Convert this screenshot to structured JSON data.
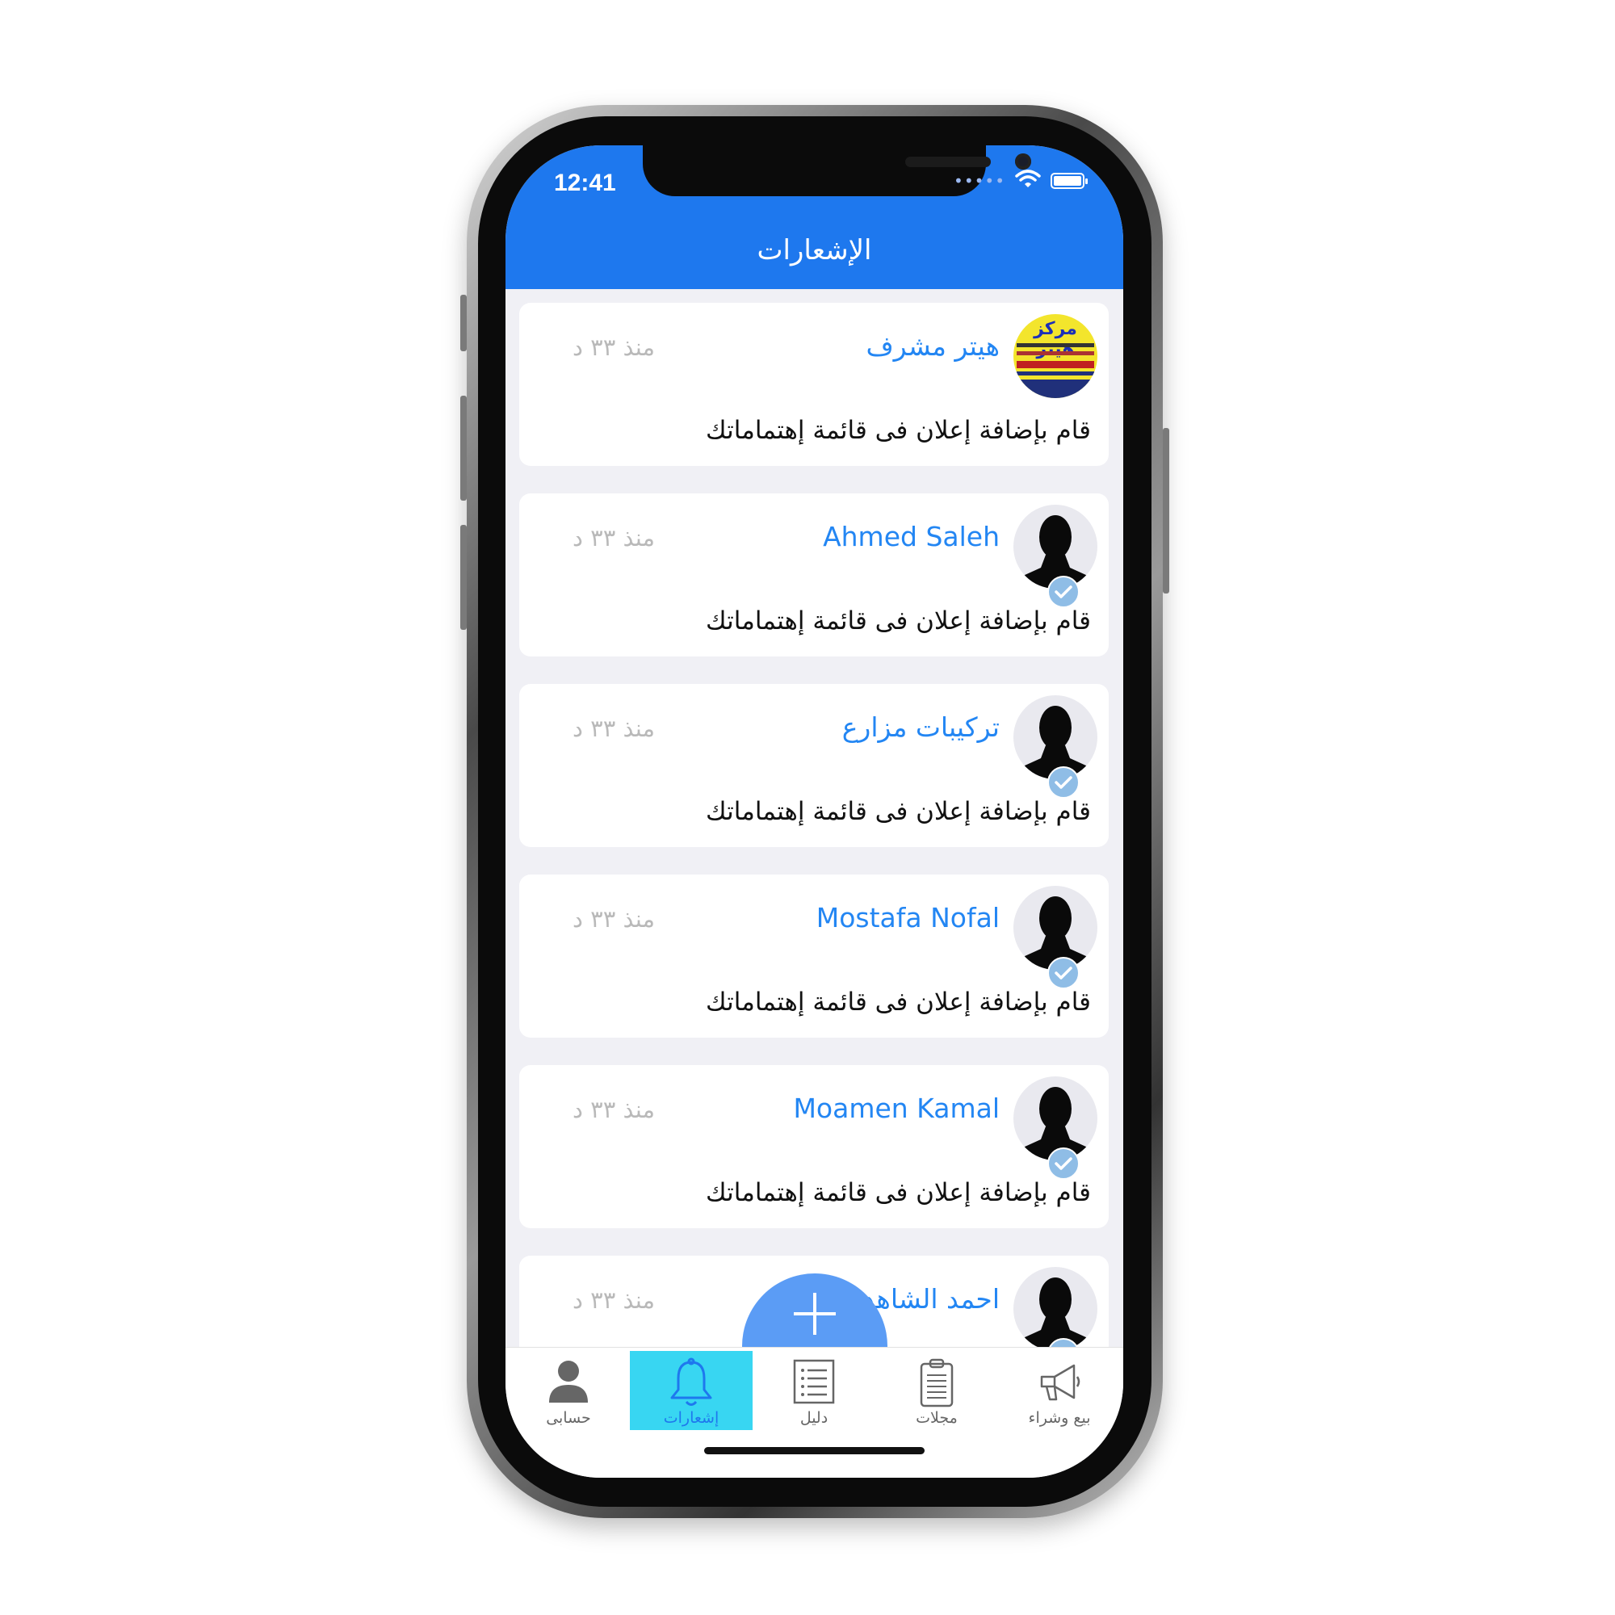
{
  "status_bar": {
    "time": "12:41",
    "signal_dots": "•••••"
  },
  "header": {
    "title": "الإشعارات"
  },
  "notifications": [
    {
      "name": "هيتر مشرف",
      "time": "منذ ٣٣ د",
      "message": "قام بإضافة إعلان فى قائمة إهتماماتك",
      "avatar": "logo"
    },
    {
      "name": "Ahmed Saleh",
      "time": "منذ ٣٣ د",
      "message": "قام بإضافة إعلان فى قائمة إهتماماتك",
      "avatar": "person"
    },
    {
      "name": "تركيبات مزارع",
      "time": "منذ ٣٣ د",
      "message": "قام بإضافة إعلان فى قائمة إهتماماتك",
      "avatar": "person"
    },
    {
      "name": "Mostafa Nofal",
      "time": "منذ ٣٣ د",
      "message": "قام بإضافة إعلان فى قائمة إهتماماتك",
      "avatar": "person"
    },
    {
      "name": "Moamen Kamal",
      "time": "منذ ٣٣ د",
      "message": "قام بإضافة إعلان فى قائمة إهتماماتك",
      "avatar": "person"
    },
    {
      "name": "احمد الشاهد",
      "time": "منذ ٣٣ د",
      "message": "",
      "avatar": "person"
    }
  ],
  "logo": {
    "title": "مركز هيتر"
  },
  "tabs": [
    {
      "label": "حسابى",
      "icon": "user-icon"
    },
    {
      "label": "إشعارات",
      "icon": "bell-icon",
      "active": true
    },
    {
      "label": "دليل",
      "icon": "list-icon"
    },
    {
      "label": "مجلات",
      "icon": "clipboard-icon"
    },
    {
      "label": "بيع وشراء",
      "icon": "megaphone-icon"
    }
  ],
  "fab": {
    "icon": "plus-icon"
  },
  "colors": {
    "header": "#1e78ee",
    "accent": "#2386f3",
    "active_tab": "#38d6f2",
    "fab": "#5b9cf5"
  }
}
